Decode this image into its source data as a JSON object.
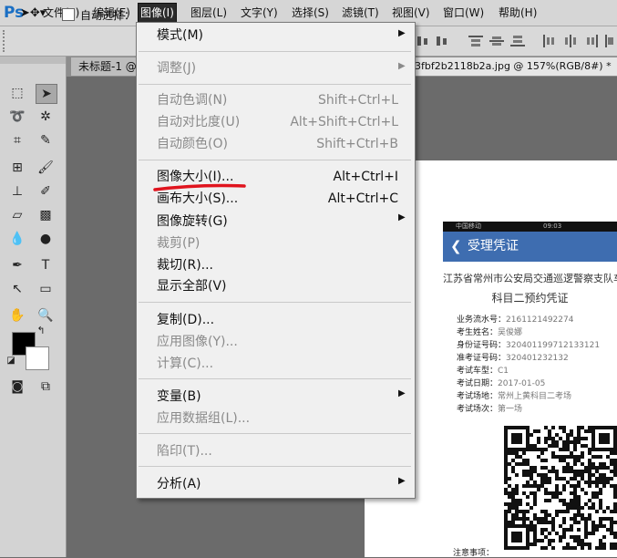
{
  "app": {
    "logo": "Ps"
  },
  "menubar": [
    {
      "label": "文件(F)",
      "active": false
    },
    {
      "label": "编辑(E)",
      "active": false
    },
    {
      "label": "图像(I)",
      "active": true
    },
    {
      "label": "图层(L)",
      "active": false
    },
    {
      "label": "文字(Y)",
      "active": false
    },
    {
      "label": "选择(S)",
      "active": false
    },
    {
      "label": "滤镜(T)",
      "active": false
    },
    {
      "label": "视图(V)",
      "active": false
    },
    {
      "label": "窗口(W)",
      "active": false
    },
    {
      "label": "帮助(H)",
      "active": false
    }
  ],
  "options": {
    "auto_select_label": "自动选择："
  },
  "tabs": [
    {
      "label": "未标题-1 @"
    },
    {
      "label": "3fbf2b2118b2a.jpg @ 157%(RGB/8#) *"
    }
  ],
  "dropdown": {
    "items": [
      {
        "label": "模式(M)",
        "shortcut": "",
        "submenu": true,
        "disabled": false
      },
      {
        "label": "调整(J)",
        "shortcut": "",
        "submenu": true,
        "disabled": true
      },
      {
        "label": "自动色调(N)",
        "shortcut": "Shift+Ctrl+L",
        "submenu": false,
        "disabled": true
      },
      {
        "label": "自动对比度(U)",
        "shortcut": "Alt+Shift+Ctrl+L",
        "submenu": false,
        "disabled": true
      },
      {
        "label": "自动颜色(O)",
        "shortcut": "Shift+Ctrl+B",
        "submenu": false,
        "disabled": true
      },
      {
        "label": "图像大小(I)...",
        "shortcut": "Alt+Ctrl+I",
        "submenu": false,
        "disabled": false
      },
      {
        "label": "画布大小(S)...",
        "shortcut": "Alt+Ctrl+C",
        "submenu": false,
        "disabled": false
      },
      {
        "label": "图像旋转(G)",
        "shortcut": "",
        "submenu": true,
        "disabled": false
      },
      {
        "label": "裁剪(P)",
        "shortcut": "",
        "submenu": false,
        "disabled": true
      },
      {
        "label": "裁切(R)...",
        "shortcut": "",
        "submenu": false,
        "disabled": false
      },
      {
        "label": "显示全部(V)",
        "shortcut": "",
        "submenu": false,
        "disabled": false
      },
      {
        "label": "复制(D)...",
        "shortcut": "",
        "submenu": false,
        "disabled": false
      },
      {
        "label": "应用图像(Y)...",
        "shortcut": "",
        "submenu": false,
        "disabled": true
      },
      {
        "label": "计算(C)...",
        "shortcut": "",
        "submenu": false,
        "disabled": true
      },
      {
        "label": "变量(B)",
        "shortcut": "",
        "submenu": true,
        "disabled": false
      },
      {
        "label": "应用数据组(L)...",
        "shortcut": "",
        "submenu": false,
        "disabled": true
      },
      {
        "label": "陷印(T)...",
        "shortcut": "",
        "submenu": false,
        "disabled": true
      },
      {
        "label": "分析(A)",
        "shortcut": "",
        "submenu": true,
        "disabled": false
      }
    ]
  },
  "document": {
    "status_carrier": "中国移动",
    "status_time": "09:03",
    "header_title": "受理凭证",
    "title_line1": "江苏省常州市公安局交通巡逻警察支队车",
    "title_line2": "科目二预约凭证",
    "fields": [
      {
        "key": "业务流水号：",
        "value": "2161121492274"
      },
      {
        "key": "考生姓名：",
        "value": "吴俊娜"
      },
      {
        "key": "身份证号码：",
        "value": "320401199712133121"
      },
      {
        "key": "准考证号码：",
        "value": "320401232132"
      },
      {
        "key": "考试车型：",
        "value": "C1"
      },
      {
        "key": "考试日期：",
        "value": "2017-01-05"
      },
      {
        "key": "考试场地：",
        "value": "常州上黄科目二考场"
      },
      {
        "key": "考试场次：",
        "value": "第一场"
      }
    ],
    "notice": "注意事项："
  },
  "colors": {
    "foreground": "#000000",
    "background": "#ffffff",
    "header_blue": "#3e6db0",
    "annotation_red": "#e0141e"
  }
}
